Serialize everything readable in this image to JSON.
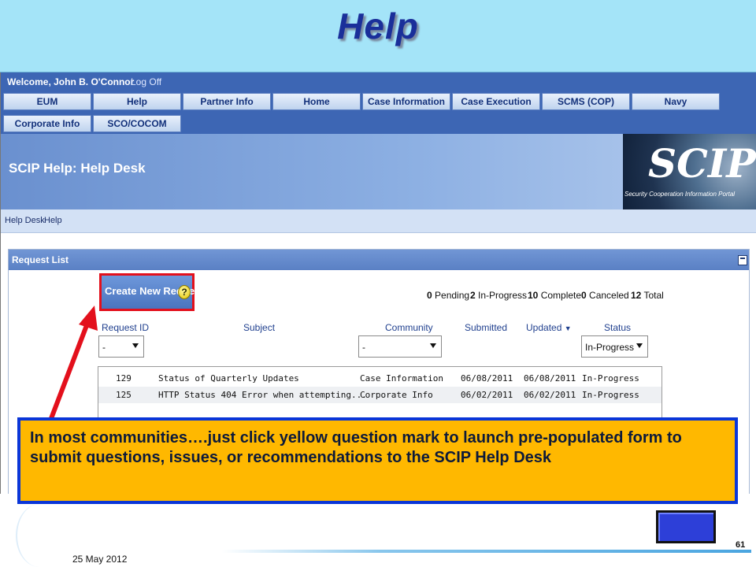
{
  "slide": {
    "title": "Help",
    "page_number": "61",
    "date": "25 May 2012"
  },
  "portal": {
    "welcome": "Welcome, John B. O'Connor",
    "logoff": "Log Off",
    "nav_row1": [
      "EUM",
      "Help",
      "Partner Info",
      "Home",
      "Case Information",
      "Case Execution",
      "SCMS (COP)",
      "Navy"
    ],
    "nav_row2": [
      "Corporate Info",
      "SCO/COCOM"
    ],
    "page_title": "SCIP Help: Help Desk",
    "logo_text": "SCIP",
    "logo_subtitle": "Security Cooperation Information Portal",
    "breadcrumbs": [
      "Help Desk",
      "Help"
    ]
  },
  "request_list": {
    "title": "Request List",
    "create_button": "Create New Request",
    "help_icon_glyph": "?",
    "counts": {
      "pending_num": "0",
      "pending_label": "Pending",
      "inprogress_num": "2",
      "inprogress_label": "In-Progress",
      "complete_num": "10",
      "complete_label": "Complete",
      "canceled_num": "0",
      "canceled_label": "Canceled",
      "total_num": "12",
      "total_label": "Total"
    },
    "columns": [
      "Request ID",
      "Subject",
      "Community",
      "Submitted",
      "Updated",
      "Status"
    ],
    "sort_indicator": "▼",
    "filters": {
      "request_id": "-",
      "community": "-",
      "status": "In-Progress"
    },
    "rows": [
      {
        "id": "129",
        "subject": "Status of Quarterly Updates",
        "community": "Case Information",
        "submitted": "06/08/2011",
        "updated": "06/08/2011",
        "status": "In-Progress"
      },
      {
        "id": "125",
        "subject": "HTTP Status 404 Error when attempting...",
        "community": "Corporate Info",
        "submitted": "06/02/2011",
        "updated": "06/02/2011",
        "status": "In-Progress"
      }
    ]
  },
  "callout": {
    "text": " In most communities….just click yellow question mark to launch pre-populated form to submit questions, issues, or recommendations to the SCIP Help Desk"
  },
  "colors": {
    "title_text": "#1a2f9a",
    "title_band": "#a4e4f8",
    "callout_fill": "#ffb800",
    "callout_border": "#0a36d8",
    "highlight_red": "#e3101c",
    "portal_blue": "#3d66b4"
  }
}
